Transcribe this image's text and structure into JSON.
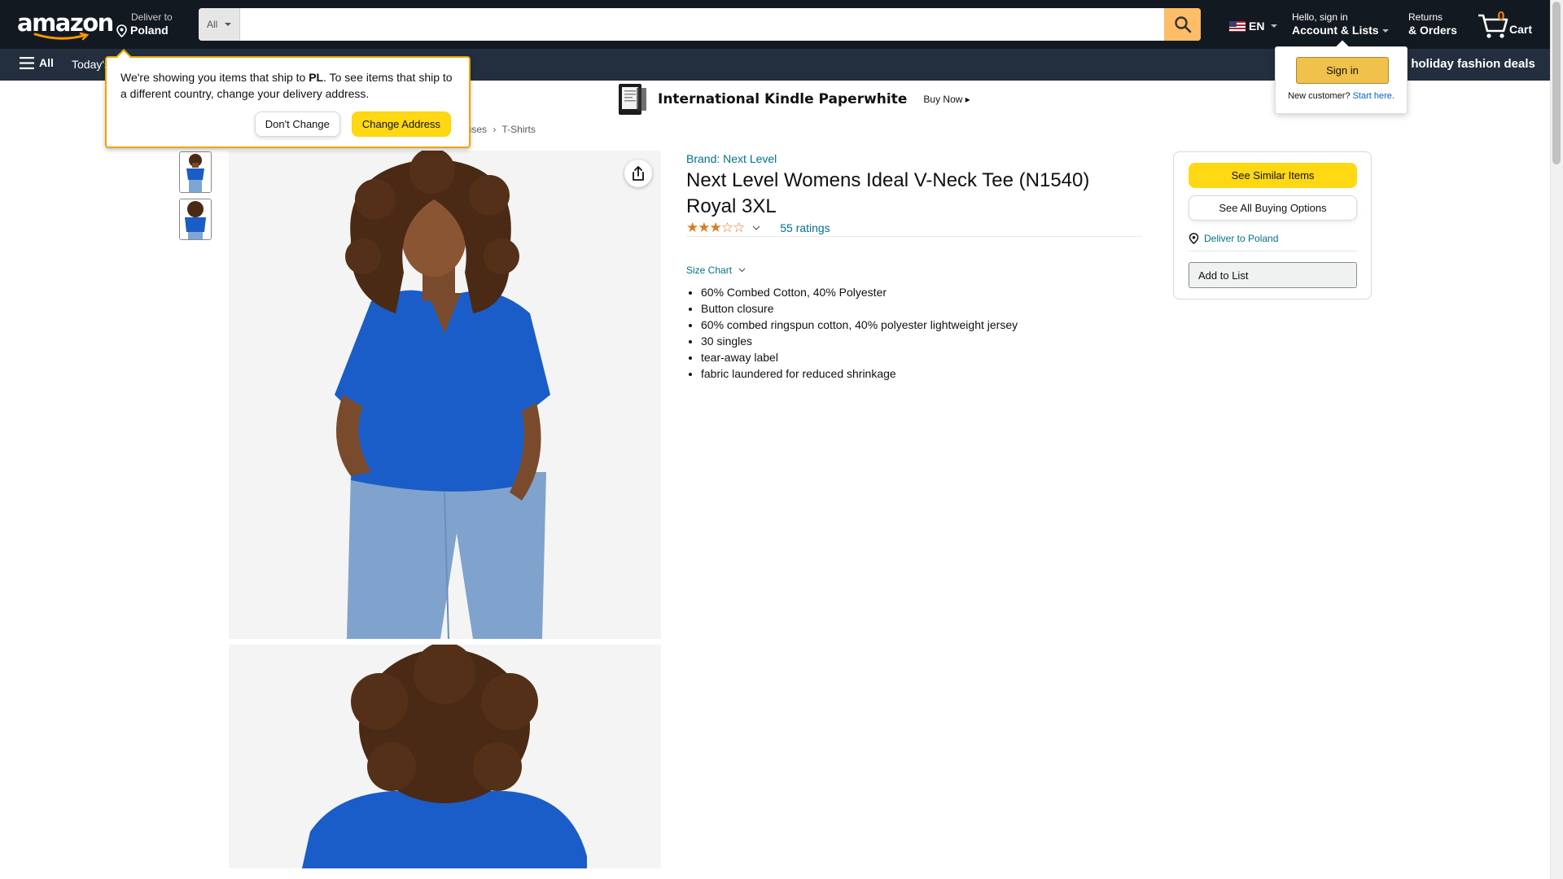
{
  "header": {
    "logo_text": "amazon",
    "deliver_line1": "Deliver to",
    "deliver_line2": "Poland",
    "search_category": "All",
    "search_placeholder": "",
    "language": "EN",
    "account_line1": "Hello, sign in",
    "account_line2": "Account & Lists",
    "returns_line1": "Returns",
    "returns_line2": "& Orders",
    "cart_count": "0",
    "cart_label": "Cart"
  },
  "subnav": {
    "all_label": "All",
    "today_label": "Today's",
    "promo_label": "o holiday fashion deals"
  },
  "ship_popover": {
    "text_before": "We're showing you items that ship to ",
    "country_code": "PL",
    "text_after": ". To see items that ship to a different country, change your delivery address.",
    "dont_change": "Don't Change",
    "change_address": "Change Address"
  },
  "signin_flyout": {
    "button": "Sign in",
    "new_customer": "New customer?",
    "start_here": "Start here."
  },
  "banner": {
    "title": "International Kindle Paperwhite",
    "cta": "Buy Now ▸"
  },
  "breadcrumb": {
    "part1": "ouses",
    "sep": "›",
    "part2": "T-Shirts"
  },
  "product": {
    "brand": "Brand: Next Level",
    "title": "Next Level Womens Ideal V-Neck Tee (N1540) Royal 3XL",
    "stars": "★★★☆☆",
    "rating_value": 3.5,
    "ratings_count": "55 ratings",
    "size_chart": "Size Chart",
    "bullets": [
      "60% Combed Cotton, 40% Polyester",
      "Button closure",
      "60% combed ringspun cotton, 40% polyester lightweight jersey",
      "30 singles",
      "tear-away label",
      "fabric laundered for reduced shrinkage"
    ]
  },
  "buybox": {
    "see_similar": "See Similar Items",
    "see_all_buying": "See All Buying Options",
    "deliver_to": "Deliver to Poland",
    "add_to_list": "Add to List"
  },
  "colors": {
    "nav_bg": "#131921",
    "subnav_bg": "#232f3e",
    "search_btn": "#febd69",
    "accent_yellow": "#ffd814",
    "link_teal": "#007185",
    "shirt_royal": "#1a5dc8"
  }
}
